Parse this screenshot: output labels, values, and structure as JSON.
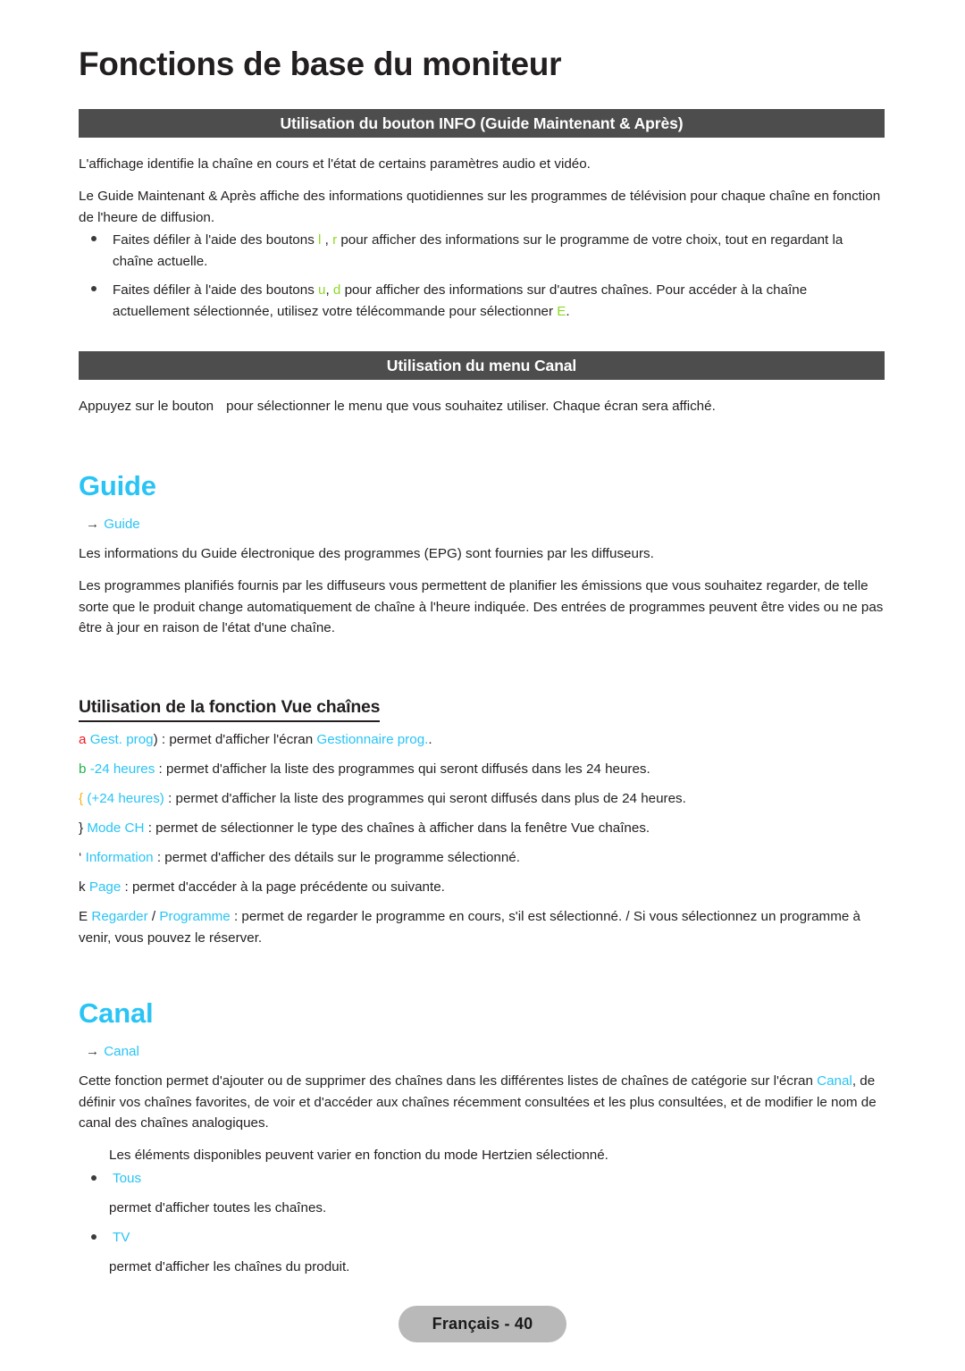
{
  "document": {
    "chapter_title": "Fonctions de base du moniteur",
    "footer_label": "Français - 40"
  },
  "colors": {
    "cyan": "#29c4f5",
    "banner_gray": "#4d4d4d",
    "footer_gray": "#b9b9b9",
    "key_green": "#8cd924",
    "key_red": "#ed1c24",
    "key_darkgreen": "#22b14c",
    "key_yellow": "#f7b11a",
    "body_text": "#231f20"
  },
  "section_info": {
    "banner": "Utilisation du bouton INFO (Guide Maintenant & Après)",
    "para1": "L'affichage identifie la chaîne en cours et l'état de certains paramètres audio et vidéo.",
    "para2": "Le Guide Maintenant & Après affiche des informations quotidiennes sur les programmes de télévision pour chaque chaîne en fonction de l'heure de diffusion.",
    "bullets": [
      {
        "pre": "Faites défiler à l'aide des boutons ",
        "key1": "l",
        "mid1": " , ",
        "key2": "r",
        "post": "  pour afficher des informations sur le programme de votre choix, tout en regardant la chaîne actuelle."
      },
      {
        "pre": "Faites défiler à l'aide des boutons ",
        "key1": "u",
        "mid1": ", ",
        "key2": "d",
        "post": " pour afficher des informations sur d'autres chaînes. Pour accéder à la chaîne actuellement sélectionnée, utilisez votre télécommande pour sélectionner ",
        "key3": "E",
        "tail": "."
      }
    ]
  },
  "section_canal_menu": {
    "banner": "Utilisation du menu Canal",
    "para_pre": "Appuyez sur le bouton",
    "para_post": "pour sélectionner le menu que vous souhaitez utiliser. Chaque écran sera affiché."
  },
  "section_guide": {
    "heading": "Guide",
    "breadcrumb_arrow": "→",
    "breadcrumb_label": "Guide",
    "para1": "Les informations du Guide électronique des programmes (EPG) sont fournies par les diffuseurs.",
    "para2": "Les programmes planifiés fournis par les diffuseurs vous permettent de planifier les émissions que vous souhaitez regarder, de telle sorte que le produit change automatiquement de chaîne à l'heure indiquée. Des entrées de programmes peuvent être vides ou ne pas être à jour en raison de l'état d'une chaîne.",
    "sub_heading": "Utilisation de la fonction Vue chaînes",
    "items": [
      {
        "key": "a",
        "key_color": "red",
        "label": "Gest. prog",
        "text_before_link": ") : permet d'afficher l'écran ",
        "link": "Gestionnaire prog.",
        "text_after": "."
      },
      {
        "key": "b",
        "key_color": "grn",
        "label": "-24 heures",
        "text_before_link": " : permet d'afficher la liste des programmes qui seront diffusés dans les 24 heures.",
        "link": "",
        "text_after": ""
      },
      {
        "key": "{",
        "key_color": "yel",
        "label": "(+24 heures)",
        "text_before_link": " : permet d'afficher la liste des programmes qui seront diffusés dans plus de 24 heures.",
        "link": "",
        "text_after": ""
      },
      {
        "key": "}",
        "key_color": "blk",
        "label": "Mode CH",
        "text_before_link": " : permet de sélectionner le type des chaînes à afficher dans la fenêtre Vue chaînes.",
        "link": "",
        "text_after": ""
      },
      {
        "key": "‘",
        "key_color": "blk",
        "label": "Information",
        "text_before_link": " : permet d'afficher des détails sur le programme sélectionné.",
        "link": "",
        "text_after": ""
      },
      {
        "key": "k",
        "key_color": "blk",
        "label": "Page",
        "text_before_link": " : permet d'accéder à la page précédente ou suivante.",
        "link": "",
        "text_after": ""
      },
      {
        "key": "E",
        "key_color": "blk",
        "label": "Regarder",
        "text_before_link": " / ",
        "link": "Programme",
        "text_after": " : permet de regarder le programme en cours, s'il est sélectionné. / Si vous sélectionnez un programme à venir, vous pouvez le réserver."
      }
    ]
  },
  "section_canal": {
    "heading": "Canal",
    "breadcrumb_arrow": "→",
    "breadcrumb_label": "Canal",
    "para_a": "Cette fonction permet d'ajouter ou de supprimer des chaînes dans les différentes listes de chaînes de catégorie sur l'écran ",
    "para_link": "Canal",
    "para_b": ", de définir vos chaînes favorites, de voir et d'accéder aux chaînes récemment consultées et les plus consultées, et de modifier le nom de canal des chaînes analogiques.",
    "note": "Les éléments disponibles peuvent varier en fonction du mode Hertzien sélectionné.",
    "options": [
      {
        "label": "Tous",
        "desc": "permet d'afficher toutes les chaînes."
      },
      {
        "label": "TV",
        "desc": "permet d'afficher les chaînes du produit."
      }
    ]
  }
}
